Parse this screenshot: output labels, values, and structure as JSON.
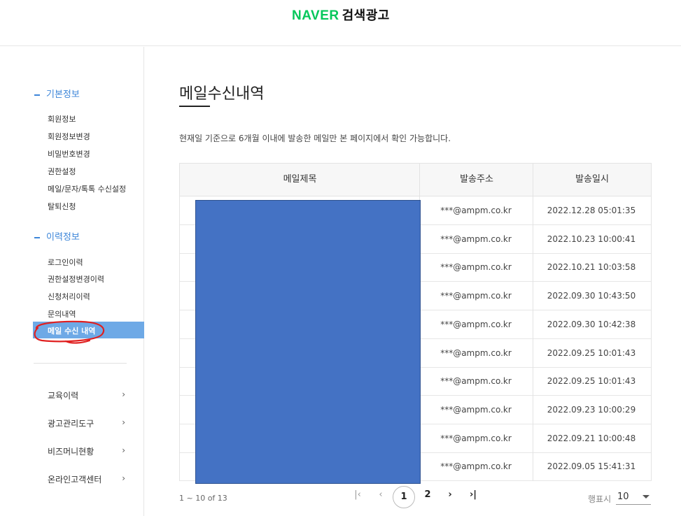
{
  "header": {
    "brand": "NAVER",
    "product": "검색광고"
  },
  "sidebar": {
    "sections": [
      {
        "title": "기본정보",
        "items": [
          "회원정보",
          "회원정보변경",
          "비밀번호변경",
          "권한설정",
          "메일/문자/톡톡 수신설정",
          "탈퇴신청"
        ]
      },
      {
        "title": "이력정보",
        "items": [
          "로그인이력",
          "권한설정변경이력",
          "신청처리이력",
          "문의내역",
          "메일 수신 내역"
        ]
      }
    ],
    "links": [
      "교육이력",
      "광고관리도구",
      "비즈머니현황",
      "온라인고객센터"
    ],
    "chevron": "›"
  },
  "main": {
    "title": "메일수신내역",
    "description": "현재일 기준으로 6개월 이내에 발송한 메일만 본 페이지에서 확인 가능합니다.",
    "table": {
      "headers": [
        "메일제목",
        "발송주소",
        "발송일시"
      ],
      "rows": [
        {
          "subject": "",
          "sender": "***@ampm.co.kr",
          "date": "2022.12.28 05:01:35"
        },
        {
          "subject": "",
          "sender": "***@ampm.co.kr",
          "date": "2022.10.23 10:00:41"
        },
        {
          "subject": "",
          "sender": "***@ampm.co.kr",
          "date": "2022.10.21 10:03:58"
        },
        {
          "subject": "",
          "sender": "***@ampm.co.kr",
          "date": "2022.09.30 10:43:50"
        },
        {
          "subject": "",
          "sender": "***@ampm.co.kr",
          "date": "2022.09.30 10:42:38"
        },
        {
          "subject": "",
          "sender": "***@ampm.co.kr",
          "date": "2022.09.25 10:01:43"
        },
        {
          "subject": "",
          "sender": "***@ampm.co.kr",
          "date": "2022.09.25 10:01:43"
        },
        {
          "subject": "",
          "sender": "***@ampm.co.kr",
          "date": "2022.09.23 10:00:29"
        },
        {
          "subject": "",
          "sender": "***@ampm.co.kr",
          "date": "2022.09.21 10:00:48"
        },
        {
          "subject": "",
          "sender": "***@ampm.co.kr",
          "date": "2022.09.05 15:41:31"
        }
      ]
    },
    "pagination": {
      "range_text": "1 ~ 10 of 13",
      "first": "|‹",
      "prev": "‹",
      "pages": [
        "1",
        "2"
      ],
      "current": "1",
      "next": "›",
      "last": "›|",
      "rows_label": "행표시",
      "rows_value": "10"
    }
  },
  "colors": {
    "brand_green": "#03c75a",
    "accent_blue": "#3d86d9",
    "active_bg": "#6ea9e6",
    "redaction": "#4472c4",
    "annotation_red": "#e02020"
  },
  "icons": [
    "chevron-right-icon",
    "first-page-icon",
    "prev-page-icon",
    "next-page-icon",
    "last-page-icon",
    "dropdown-caret-icon"
  ]
}
